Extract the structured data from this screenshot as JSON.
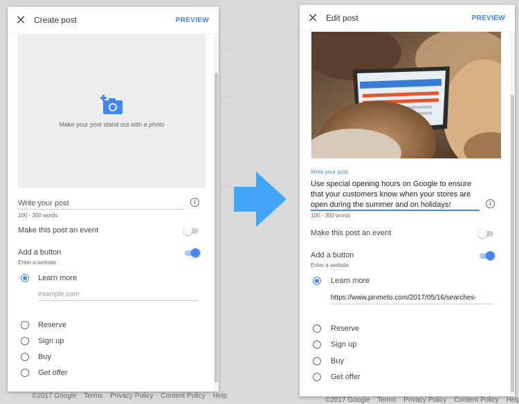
{
  "create_panel": {
    "close_icon": "close-icon",
    "title": "Create post",
    "preview_label": "PREVIEW",
    "photo_hint": "Make your post stand out with a photo",
    "write_post_placeholder": "Write your post",
    "word_hint": "100 - 300 words",
    "event_label": "Make this post an event",
    "event_toggle_on": false,
    "button_label": "Add a button",
    "button_toggle_on": true,
    "enter_website": "Enter a website",
    "options": [
      "Learn more",
      "Reserve",
      "Sign up",
      "Buy",
      "Get offer"
    ],
    "selected_option": "Learn more",
    "website_placeholder": "example.com"
  },
  "edit_panel": {
    "close_icon": "close-icon",
    "title": "Edit post",
    "preview_label": "PREVIEW",
    "write_post_label": "Write your post",
    "post_text": "Use special opening hours on Google to ensure that your customers know when your stores are open during the summer and on holidays!",
    "word_hint": "100 - 300 words",
    "event_label": "Make this post an event",
    "event_toggle_on": false,
    "button_label": "Add a button",
    "button_toggle_on": true,
    "enter_website": "Enter a website",
    "options": [
      "Learn more",
      "Reserve",
      "Sign up",
      "Buy",
      "Get offer"
    ],
    "selected_option": "Learn more",
    "website_value": "https://www.pinmeto.com/2017/05/16/searches-"
  },
  "footer": {
    "copyright": "©2017 Google",
    "terms": "Terms",
    "privacy": "Privacy Policy",
    "content_policy": "Content Policy",
    "help": "Help"
  },
  "colors": {
    "accent": "#4285f4",
    "arrow": "#42a5f5"
  }
}
